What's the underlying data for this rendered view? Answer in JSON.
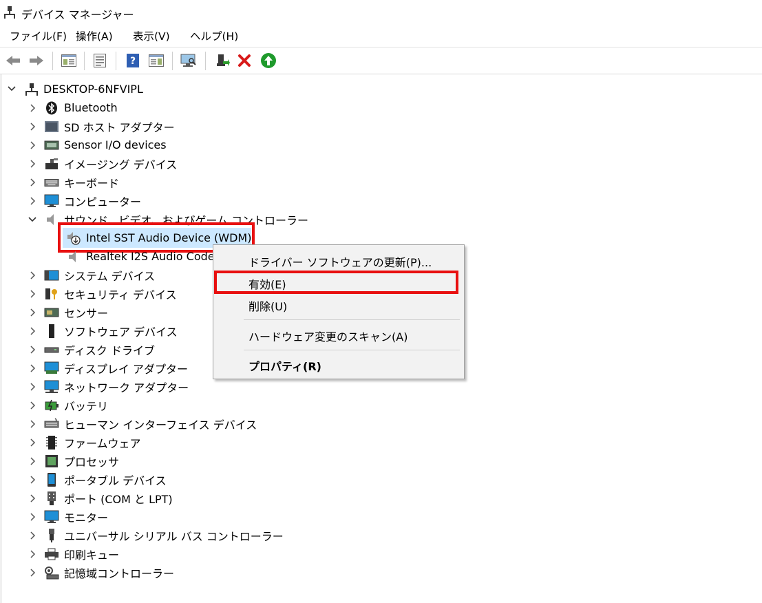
{
  "window": {
    "title": "デバイス マネージャー"
  },
  "menu": [
    "ファイル(F)",
    "操作(A)",
    "表示(V)",
    "ヘルプ(H)"
  ],
  "toolbar": [
    "back-icon",
    "forward-icon",
    "show-hide-console-tree-icon",
    "properties-icon",
    "help-icon",
    "action-pane-icon",
    "scan-hardware-icon",
    "update-driver-icon",
    "uninstall-icon",
    "enable-device-icon"
  ],
  "tree": {
    "root": "DESKTOP-6NFVIPL",
    "items": [
      "Bluetooth",
      "SD ホスト アダプター",
      "Sensor I/O devices",
      "イメージング デバイス",
      "キーボード",
      "コンピューター",
      "サウンド、ビデオ、およびゲーム コントローラー",
      "Intel SST Audio Device (WDM)",
      "Realtek I2S Audio Codec",
      "システム デバイス",
      "セキュリティ デバイス",
      "センサー",
      "ソフトウェア デバイス",
      "ディスク ドライブ",
      "ディスプレイ アダプター",
      "ネットワーク アダプター",
      "バッテリ",
      "ヒューマン インターフェイス デバイス",
      "ファームウェア",
      "プロセッサ",
      "ポータブル デバイス",
      "ポート (COM と LPT)",
      "モニター",
      "ユニバーサル シリアル バス コントローラー",
      "印刷キュー",
      "記憶域コントローラー"
    ]
  },
  "context_menu": {
    "items": [
      "ドライバー ソフトウェアの更新(P)...",
      "有効(E)",
      "削除(U)",
      "ハードウェア変更のスキャン(A)",
      "プロパティ(R)"
    ]
  },
  "colors": {
    "highlight": "#e81010",
    "selection": "#cce8ff"
  }
}
